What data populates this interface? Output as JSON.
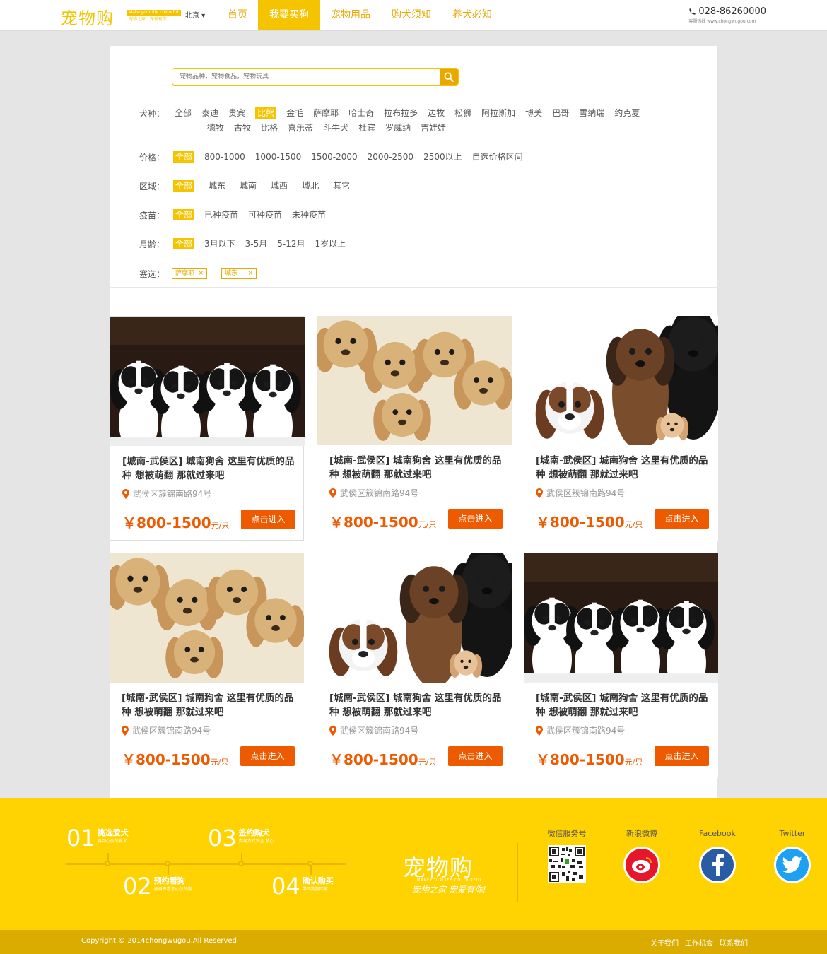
{
  "header": {
    "logo": "宠物购",
    "logo_tag_top": "Make your life colourful",
    "logo_tag_bottom": "宠物之家 · 宠爱有你",
    "city": "北京",
    "nav": [
      "首页",
      "我要买狗",
      "宠物用品",
      "购犬须知",
      "养犬必知"
    ],
    "active_nav": 1,
    "phone": "028-86260000",
    "phone_sub": "客服热线 www.chongwugou.com"
  },
  "search": {
    "placeholder": "宠物品种，宠物食品，宠物玩具...."
  },
  "filters": {
    "breed_label": "犬种：",
    "breeds": [
      "全部",
      "泰迪",
      "贵宾",
      "比熊",
      "金毛",
      "萨摩耶",
      "哈士奇",
      "拉布拉多",
      "边牧",
      "松狮",
      "阿拉斯加",
      "博美",
      "巴哥",
      "雪纳瑞",
      "约克夏"
    ],
    "breeds_line2": [
      "德牧",
      "古牧",
      "比格",
      "喜乐蒂",
      "斗牛犬",
      "杜宾",
      "罗威纳",
      "吉娃娃"
    ],
    "breed_selected": "比熊",
    "price_label": "价格：",
    "prices": [
      "全部",
      "800-1000",
      "1000-1500",
      "1500-2000",
      "2000-2500",
      "2500以上",
      "自选价格区间"
    ],
    "area_label": "区域：",
    "areas": [
      "全部",
      "城东",
      "城南",
      "城西",
      "城北",
      "其它"
    ],
    "vaccine_label": "疫苗：",
    "vaccines": [
      "全部",
      "已种疫苗",
      "可种疫苗",
      "未种疫苗"
    ],
    "age_label": "月龄：",
    "ages": [
      "全部",
      "3月以下",
      "3-5月",
      "5-12月",
      "1岁以上"
    ],
    "selected_label": "塞选：",
    "selected_tags": [
      "萨摩耶",
      "城东"
    ],
    "tag_close": "×"
  },
  "cards": [
    {
      "title": "[城南-武侯区] 城南狗舍 这里有优质的品种 想被萌翻 那就过来吧",
      "address": "武侯区簇锦南路94号",
      "price": "￥800-1500",
      "unit": "元/只",
      "button": "点击进入",
      "image": "spaniel-puppies-photo"
    },
    {
      "title": "[城南-武侯区] 城南狗舍 这里有优质的品种 想被萌翻 那就过来吧",
      "address": "武侯区簇锦南路94号",
      "price": "￥800-1500",
      "unit": "元/只",
      "button": "点击进入",
      "image": "golden-puppies-photo"
    },
    {
      "title": "[城南-武侯区] 城南狗舍 这里有优质的品种 想被萌翻 那就过来吧",
      "address": "武侯区簇锦南路94号",
      "price": "￥800-1500",
      "unit": "元/只",
      "button": "点击进入",
      "image": "large-dogs-photo"
    },
    {
      "title": "[城南-武侯区] 城南狗舍 这里有优质的品种 想被萌翻 那就过来吧",
      "address": "武侯区簇锦南路94号",
      "price": "￥800-1500",
      "unit": "元/只",
      "button": "点击进入",
      "image": "golden-puppies-photo"
    },
    {
      "title": "[城南-武侯区] 城南狗舍 这里有优质的品种 想被萌翻 那就过来吧",
      "address": "武侯区簇锦南路94号",
      "price": "￥800-1500",
      "unit": "元/只",
      "button": "点击进入",
      "image": "large-dogs-photo"
    },
    {
      "title": "[城南-武侯区] 城南狗舍 这里有优质的品种 想被萌翻 那就过来吧",
      "address": "武侯区簇锦南路94号",
      "price": "￥800-1500",
      "unit": "元/只",
      "button": "点击进入",
      "image": "spaniel-puppies-photo"
    }
  ],
  "footer": {
    "steps": [
      {
        "num": "01",
        "name": "挑选爱犬",
        "desc": "挑到心仪的爱犬"
      },
      {
        "num": "02",
        "name": "预约看狗",
        "desc": "亲自去看您心仪的狗"
      },
      {
        "num": "03",
        "name": "签约购犬",
        "desc": "交易方式安全 放心"
      },
      {
        "num": "04",
        "name": "确认购买",
        "desc": "带回狗狗回家"
      }
    ],
    "logo": "宠物购",
    "logo_sub": "MAKEYOURLIFE COLOURFUL",
    "slogan": "宠物之家 宠爱有你!",
    "social": [
      {
        "label": "微信服务号",
        "icon": "qr-code-icon"
      },
      {
        "label": "新浪微博",
        "icon": "weibo-icon",
        "color": "#e6162d"
      },
      {
        "label": "Facebook",
        "icon": "facebook-icon",
        "color": "#2a5ca6"
      },
      {
        "label": "Twitter",
        "icon": "twitter-icon",
        "color": "#1da1f2"
      }
    ],
    "copyright": "Copyright © 2014chongwugou,All Reserved",
    "links": [
      "关于我们",
      "工作机会",
      "联系我们"
    ]
  },
  "colors": {
    "brand_yellow": "#f5c400",
    "accent_orange": "#ee5a00",
    "footer_yellow": "#ffd302"
  }
}
